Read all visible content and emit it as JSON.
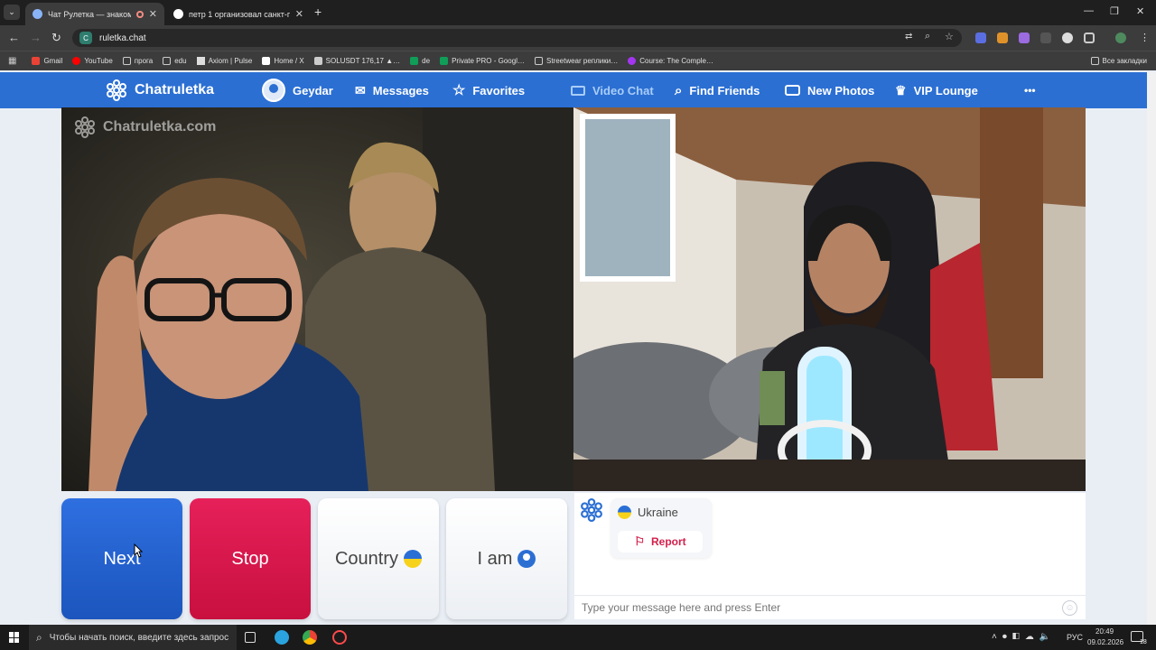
{
  "browser": {
    "tabs": [
      {
        "title": "Чат Рулетка — знакомств…",
        "active": true
      },
      {
        "title": "петр 1 организовал санкт-пе…",
        "active": false
      }
    ],
    "new_tab": "+",
    "url": "ruletka.chat",
    "bookmarks": [
      "Gmail",
      "YouTube",
      "прога",
      "edu",
      "Axiom | Pulse",
      "Home / X",
      "SOLUSDT 176,17 ▲…",
      "de",
      "Private PRO - Googl…",
      "Streetwear реплики…",
      "Course: The Comple…"
    ],
    "all_bookmarks": "Все закладки"
  },
  "site": {
    "brand": "Chatruletka",
    "user": "Geydar",
    "nav": {
      "messages": "Messages",
      "favorites": "Favorites",
      "video_chat": "Video Chat",
      "find_friends": "Find Friends",
      "new_photos": "New Photos",
      "vip_lounge": "VIP Lounge",
      "more": "•••"
    },
    "watermark": "Chatruletka.com"
  },
  "controls": {
    "next": "Next",
    "stop": "Stop",
    "country": "Country",
    "i_am": "I am"
  },
  "chat": {
    "partner_country": "Ukraine",
    "report": "Report",
    "placeholder": "Type your message here and press Enter"
  },
  "taskbar": {
    "search_placeholder": "Чтобы начать поиск, введите здесь запрос",
    "lang": "РУС",
    "time": "20:49",
    "date": "09.02.2026",
    "notifications": "18"
  },
  "colors": {
    "brand_blue": "#2b6fd3",
    "next": "#1f5fc9",
    "stop": "#d8194b"
  }
}
